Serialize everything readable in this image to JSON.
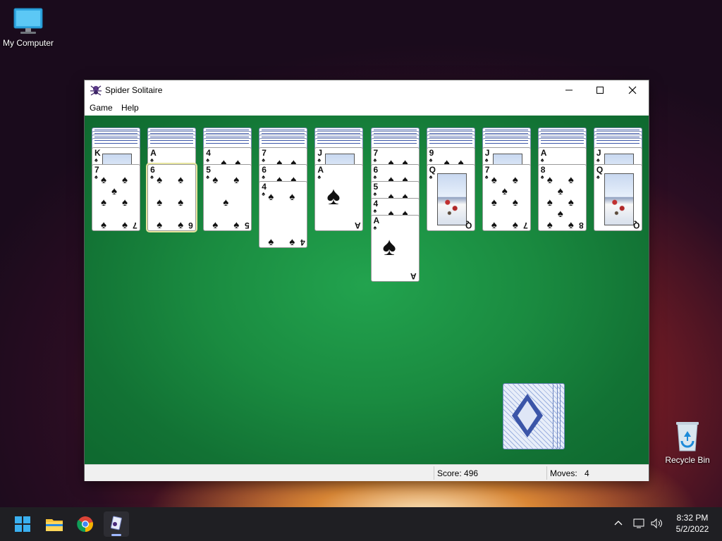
{
  "desktop": {
    "icons": [
      {
        "label": "My Computer"
      },
      {
        "label": "Recycle Bin"
      }
    ]
  },
  "window": {
    "title": "Spider Solitaire",
    "menu": [
      "Game",
      "Help"
    ],
    "status": {
      "score": "Score: 496",
      "moves_label": "Moves:",
      "moves_value": "4"
    }
  },
  "tableau": [
    {
      "hidden": 4,
      "cards": [
        {
          "rank": "K"
        },
        {
          "rank": "7"
        }
      ]
    },
    {
      "hidden": 4,
      "cards": [
        {
          "rank": "A"
        },
        {
          "rank": "6",
          "selected": true
        }
      ]
    },
    {
      "hidden": 4,
      "cards": [
        {
          "rank": "4"
        },
        {
          "rank": "5"
        }
      ]
    },
    {
      "hidden": 4,
      "cards": [
        {
          "rank": "7"
        },
        {
          "rank": "6"
        },
        {
          "rank": "4"
        }
      ]
    },
    {
      "hidden": 4,
      "cards": [
        {
          "rank": "J"
        },
        {
          "rank": "A"
        }
      ]
    },
    {
      "hidden": 4,
      "cards": [
        {
          "rank": "7"
        },
        {
          "rank": "6"
        },
        {
          "rank": "5"
        },
        {
          "rank": "4"
        },
        {
          "rank": "A"
        }
      ]
    },
    {
      "hidden": 4,
      "cards": [
        {
          "rank": "9"
        },
        {
          "rank": "Q"
        }
      ]
    },
    {
      "hidden": 4,
      "cards": [
        {
          "rank": "J"
        },
        {
          "rank": "7"
        }
      ]
    },
    {
      "hidden": 4,
      "cards": [
        {
          "rank": "A"
        },
        {
          "rank": "8"
        }
      ]
    },
    {
      "hidden": 4,
      "cards": [
        {
          "rank": "J"
        },
        {
          "rank": "Q"
        }
      ]
    }
  ],
  "suit_symbol": "♠",
  "taskbar": {
    "apps": [
      "start-icon",
      "file-explorer-icon",
      "chrome-icon",
      "spider-solitaire-icon"
    ],
    "time": "8:32 PM",
    "date": "5/2/2022"
  }
}
